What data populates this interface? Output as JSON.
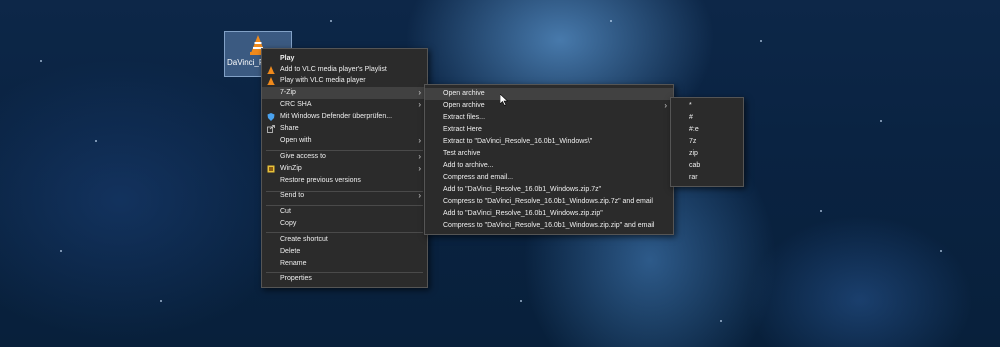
{
  "desktop_icon": {
    "label": "DaVinci_Re...0b1_Win..."
  },
  "context_menu": {
    "items": [
      {
        "label": "Play"
      },
      {
        "label": "Add to VLC media player's Playlist"
      },
      {
        "label": "Play with VLC media player"
      },
      {
        "label": "7-Zip"
      },
      {
        "label": "CRC SHA"
      },
      {
        "label": "Mit Windows Defender überprüfen..."
      },
      {
        "label": "Share"
      },
      {
        "label": "Open with"
      },
      {
        "label": "Give access to"
      },
      {
        "label": "WinZip"
      },
      {
        "label": "Restore previous versions"
      },
      {
        "label": "Send to"
      },
      {
        "label": "Cut"
      },
      {
        "label": "Copy"
      },
      {
        "label": "Create shortcut"
      },
      {
        "label": "Delete"
      },
      {
        "label": "Rename"
      },
      {
        "label": "Properties"
      }
    ]
  },
  "zip_menu": {
    "items": [
      {
        "label": "Open archive"
      },
      {
        "label": "Open archive"
      },
      {
        "label": "Extract files..."
      },
      {
        "label": "Extract Here"
      },
      {
        "label": "Extract to \"DaVinci_Resolve_16.0b1_Windows\\\""
      },
      {
        "label": "Test archive"
      },
      {
        "label": "Add to archive..."
      },
      {
        "label": "Compress and email..."
      },
      {
        "label": "Add to \"DaVinci_Resolve_16.0b1_Windows.zip.7z\""
      },
      {
        "label": "Compress to \"DaVinci_Resolve_16.0b1_Windows.zip.7z\" and email"
      },
      {
        "label": "Add to \"DaVinci_Resolve_16.0b1_Windows.zip.zip\""
      },
      {
        "label": "Compress to \"DaVinci_Resolve_16.0b1_Windows.zip.zip\" and email"
      }
    ]
  },
  "format_menu": {
    "items": [
      "*",
      "#",
      "#:e",
      "7z",
      "zip",
      "cab",
      "rar"
    ]
  },
  "colors": {
    "menu_bg": "#2b2b2b",
    "highlight": "#414141",
    "text": "#f0f0f0",
    "vlc_orange": "#f08a1c"
  }
}
